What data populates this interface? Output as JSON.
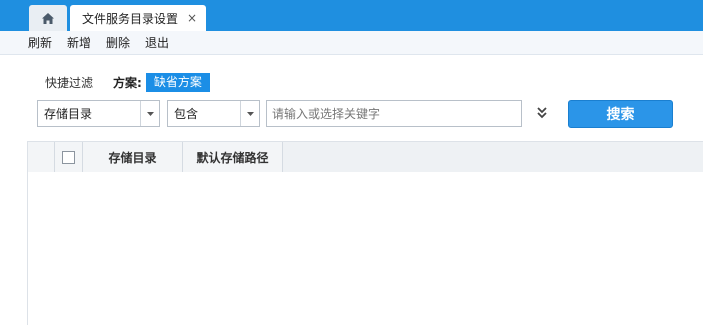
{
  "tabs": {
    "home_icon": "home-icon",
    "active_tab_label": "文件服务目录设置",
    "close_symbol": "×"
  },
  "menu": {
    "items": [
      "刷新",
      "新增",
      "删除",
      "退出"
    ]
  },
  "filter": {
    "quick_filter_label": "快捷过滤",
    "scheme_label": "方案:",
    "scheme_value": "缺省方案"
  },
  "search": {
    "field_select": "存储目录",
    "operator_select": "包含",
    "keyword_placeholder": "请输入或选择关键字",
    "search_button": "搜索"
  },
  "grid": {
    "columns": [
      "存储目录",
      "默认存储路径"
    ]
  },
  "colors": {
    "tabbar": "#1f8fe0",
    "accent": "#2b95e8"
  }
}
